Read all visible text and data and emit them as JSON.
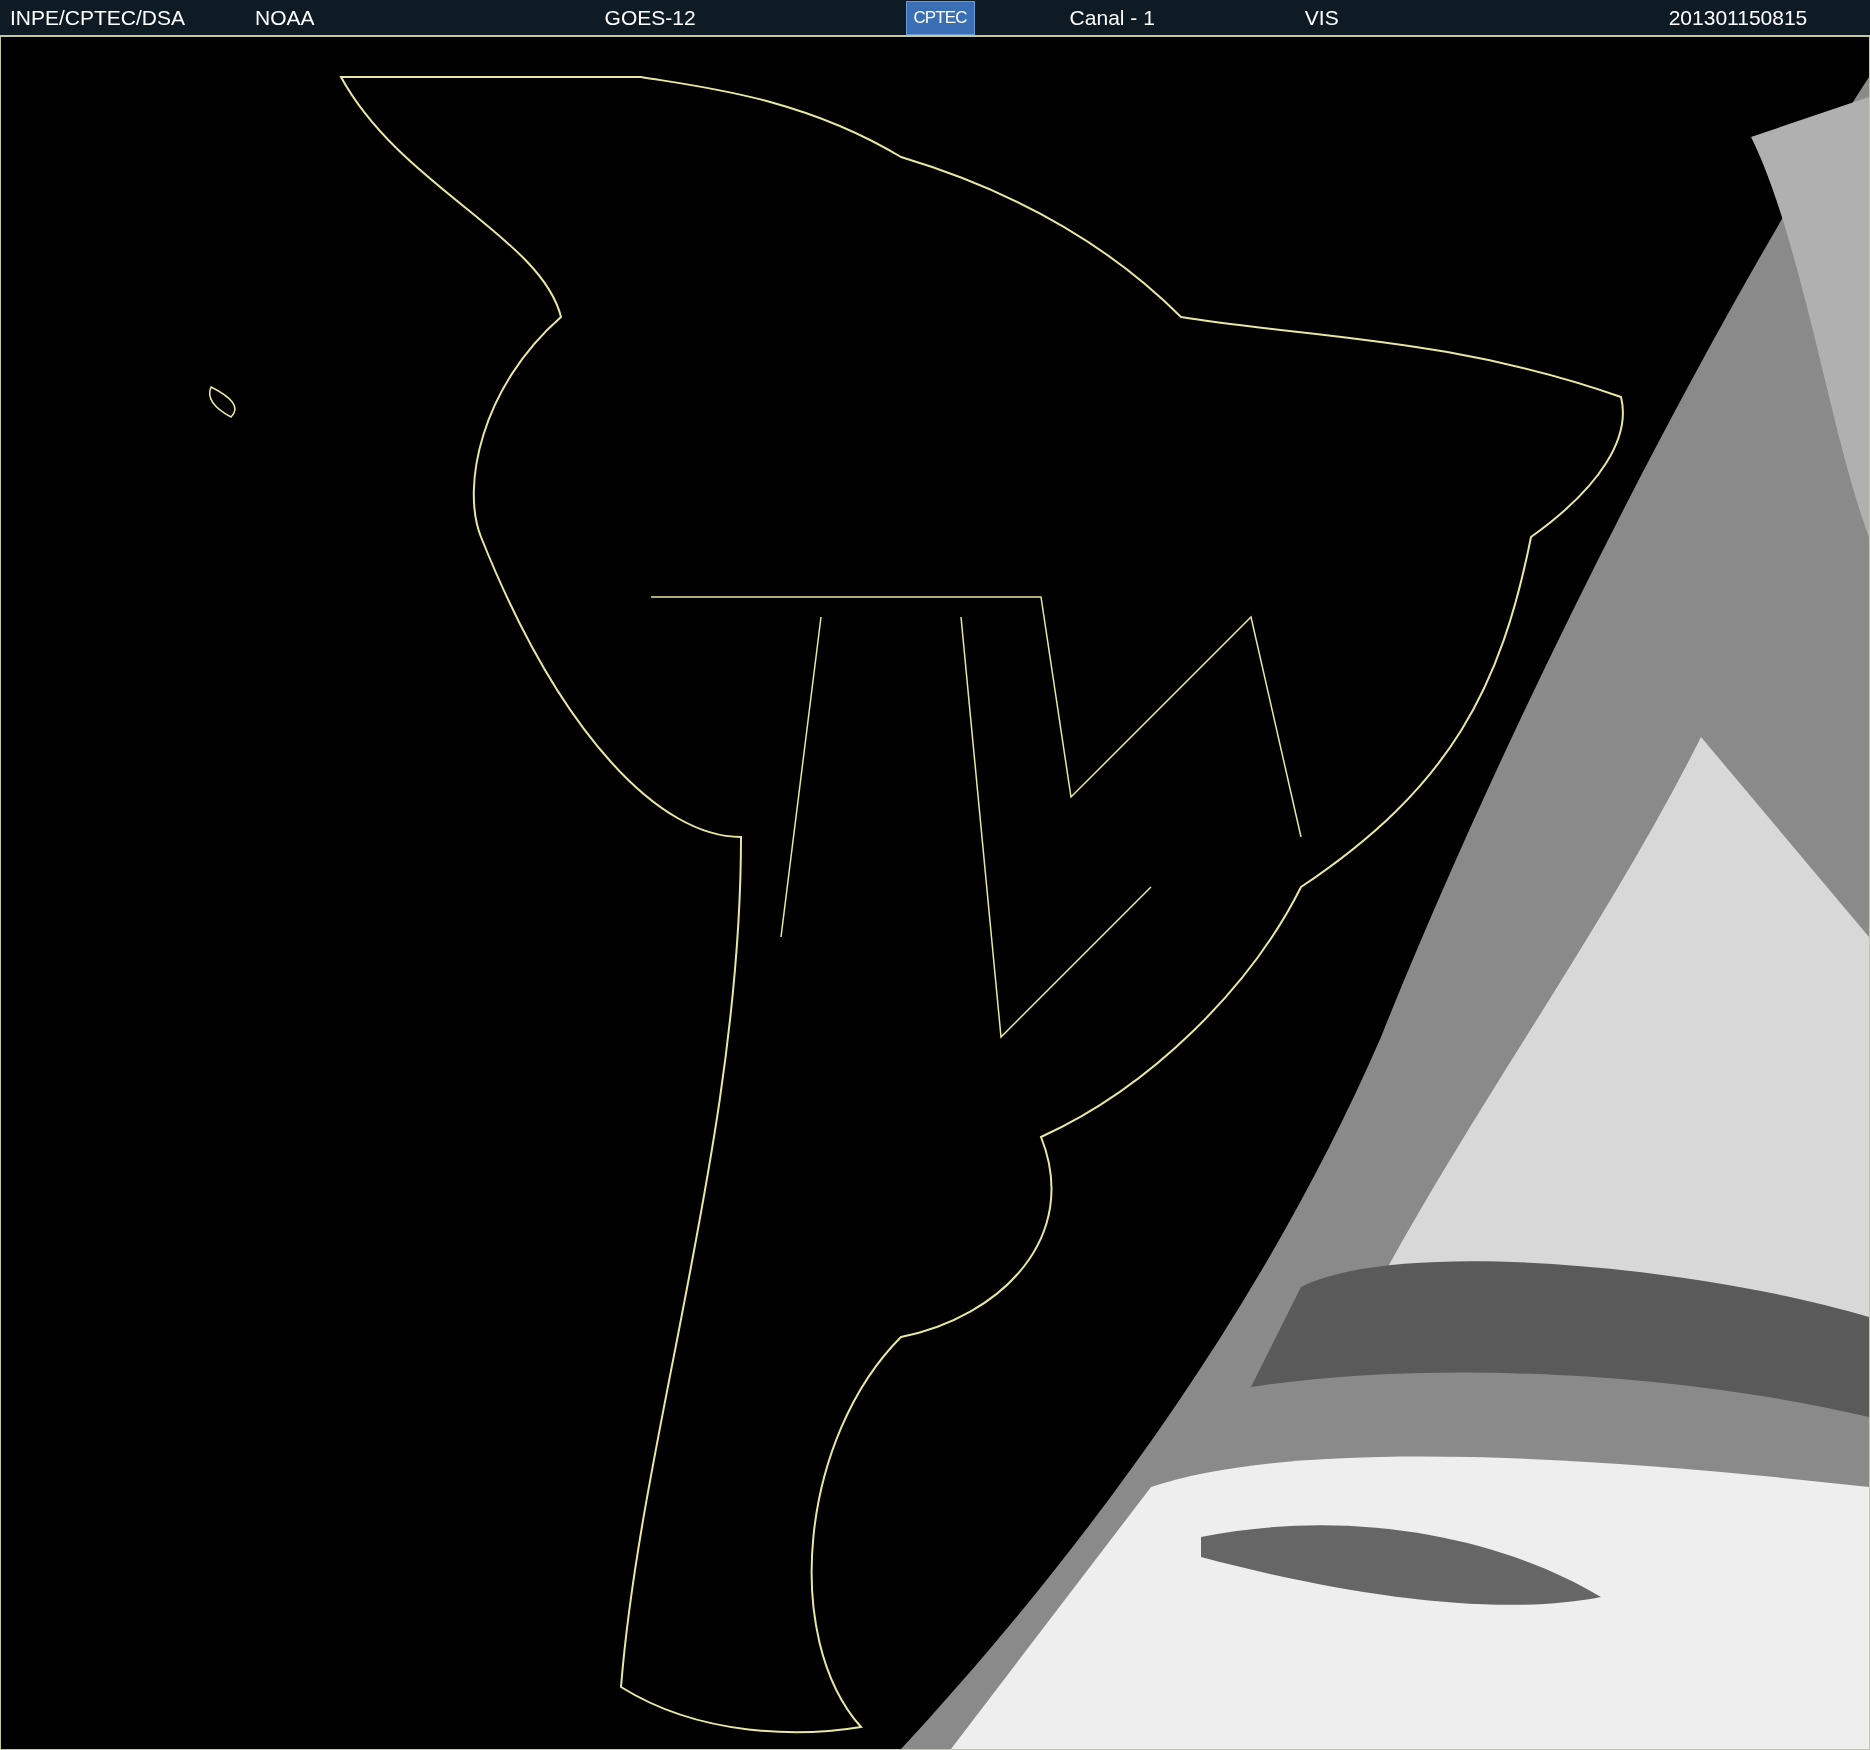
{
  "header": {
    "items": [
      {
        "kind": "text",
        "text": "INPE/CPTEC/DSA"
      },
      {
        "kind": "text",
        "text": "NOAA"
      },
      {
        "kind": "text",
        "text": "GOES-12"
      },
      {
        "kind": "logo",
        "text": "CPTEC"
      },
      {
        "kind": "text",
        "text": "Canal - 1"
      },
      {
        "kind": "text",
        "text": "VIS"
      },
      {
        "kind": "text",
        "text": "201301150815"
      }
    ]
  }
}
